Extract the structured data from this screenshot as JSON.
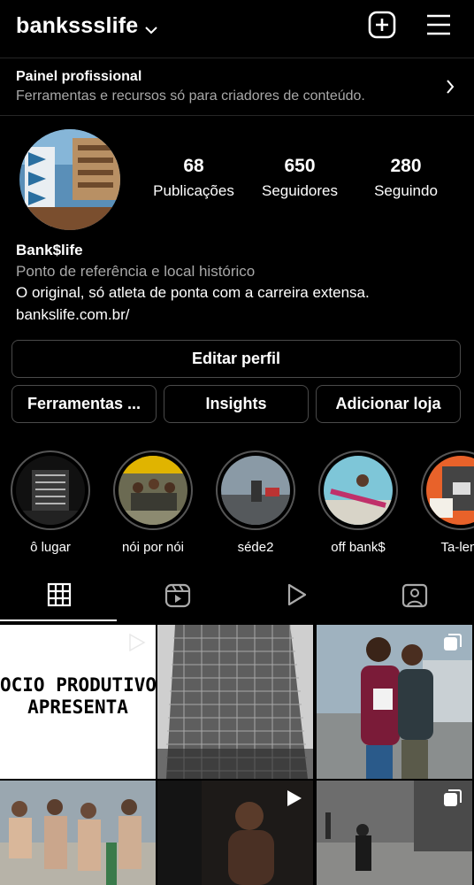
{
  "header": {
    "username": "bankssslife"
  },
  "pro_panel": {
    "title": "Painel profissional",
    "subtitle": "Ferramentas e recursos só para criadores de conteúdo."
  },
  "profile": {
    "stats": [
      {
        "value": "68",
        "label": "Publicações"
      },
      {
        "value": "650",
        "label": "Seguidores"
      },
      {
        "value": "280",
        "label": "Seguindo"
      }
    ],
    "name": "Bank$life",
    "category": "Ponto de referência e local histórico",
    "bio": "O original, só atleta de ponta com a carreira extensa.",
    "link": "bankslife.com.br/"
  },
  "buttons": {
    "edit": "Editar perfil",
    "tools": "Ferramentas ...",
    "insights": "Insights",
    "shop": "Adicionar loja"
  },
  "highlights": [
    {
      "label": "ô lugar"
    },
    {
      "label": "nói por nói"
    },
    {
      "label": "séde2"
    },
    {
      "label": "off bank$"
    },
    {
      "label": "Ta-lent"
    }
  ],
  "tabs": [
    "grid",
    "reels",
    "videos",
    "tagged"
  ],
  "posts": [
    {
      "type": "reel",
      "text_line1": "OCIO PRODUTIVO",
      "text_line2": "APRESENTA"
    },
    {
      "type": "photo"
    },
    {
      "type": "carousel"
    },
    {
      "type": "photo"
    },
    {
      "type": "reel"
    },
    {
      "type": "carousel"
    }
  ],
  "colors": {
    "background": "#000000",
    "secondary_text": "#a8a8a8",
    "border": "#4a4a4a"
  }
}
